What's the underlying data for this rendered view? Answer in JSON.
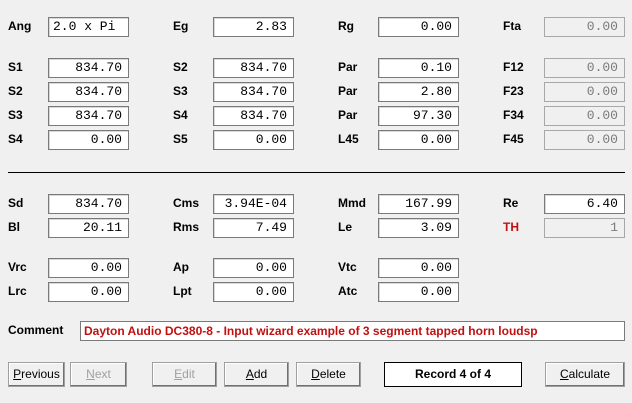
{
  "params": {
    "ang": {
      "label": "Ang",
      "value": "2.0 x Pi"
    },
    "eg": {
      "label": "Eg",
      "value": "2.83"
    },
    "rg": {
      "label": "Rg",
      "value": "0.00"
    },
    "fta": {
      "label": "Fta",
      "value": "0.00"
    },
    "s1": {
      "label": "S1",
      "value": "834.70"
    },
    "s2a": {
      "label": "S2",
      "value": "834.70"
    },
    "par1": {
      "label": "Par",
      "value": "0.10"
    },
    "f12": {
      "label": "F12",
      "value": "0.00"
    },
    "s2b": {
      "label": "S2",
      "value": "834.70"
    },
    "s3a": {
      "label": "S3",
      "value": "834.70"
    },
    "par2": {
      "label": "Par",
      "value": "2.80"
    },
    "f23": {
      "label": "F23",
      "value": "0.00"
    },
    "s3b": {
      "label": "S3",
      "value": "834.70"
    },
    "s4a": {
      "label": "S4",
      "value": "834.70"
    },
    "par3": {
      "label": "Par",
      "value": "97.30"
    },
    "f34": {
      "label": "F34",
      "value": "0.00"
    },
    "s4b": {
      "label": "S4",
      "value": "0.00"
    },
    "s5": {
      "label": "S5",
      "value": "0.00"
    },
    "l45": {
      "label": "L45",
      "value": "0.00"
    },
    "f45": {
      "label": "F45",
      "value": "0.00"
    },
    "sd": {
      "label": "Sd",
      "value": "834.70"
    },
    "cms": {
      "label": "Cms",
      "value": "3.94E-04"
    },
    "mmd": {
      "label": "Mmd",
      "value": "167.99"
    },
    "re": {
      "label": "Re",
      "value": "6.40"
    },
    "bl": {
      "label": "Bl",
      "value": "20.11"
    },
    "rms": {
      "label": "Rms",
      "value": "7.49"
    },
    "le": {
      "label": "Le",
      "value": "3.09"
    },
    "th": {
      "label": "TH",
      "value": "1"
    },
    "vrc": {
      "label": "Vrc",
      "value": "0.00"
    },
    "ap": {
      "label": "Ap",
      "value": "0.00"
    },
    "vtc": {
      "label": "Vtc",
      "value": "0.00"
    },
    "lrc": {
      "label": "Lrc",
      "value": "0.00"
    },
    "lpt": {
      "label": "Lpt",
      "value": "0.00"
    },
    "atc": {
      "label": "Atc",
      "value": "0.00"
    }
  },
  "comment": {
    "label": "Comment",
    "value": "Dayton Audio  DC380-8 - Input wizard example of 3 segment tapped horn loudsp"
  },
  "buttons": {
    "previous": {
      "pre": "",
      "key": "P",
      "post": "revious"
    },
    "next": {
      "pre": "",
      "key": "N",
      "post": "ext"
    },
    "edit": {
      "pre": "",
      "key": "E",
      "post": "dit"
    },
    "add": {
      "pre": "",
      "key": "A",
      "post": "dd"
    },
    "delete": {
      "pre": "",
      "key": "D",
      "post": "elete"
    },
    "calculate": {
      "pre": "",
      "key": "C",
      "post": "alculate"
    }
  },
  "record_status": "Record 4 of 4",
  "colors": {
    "accent_red": "#c01010",
    "background": "#f0f0f0"
  }
}
